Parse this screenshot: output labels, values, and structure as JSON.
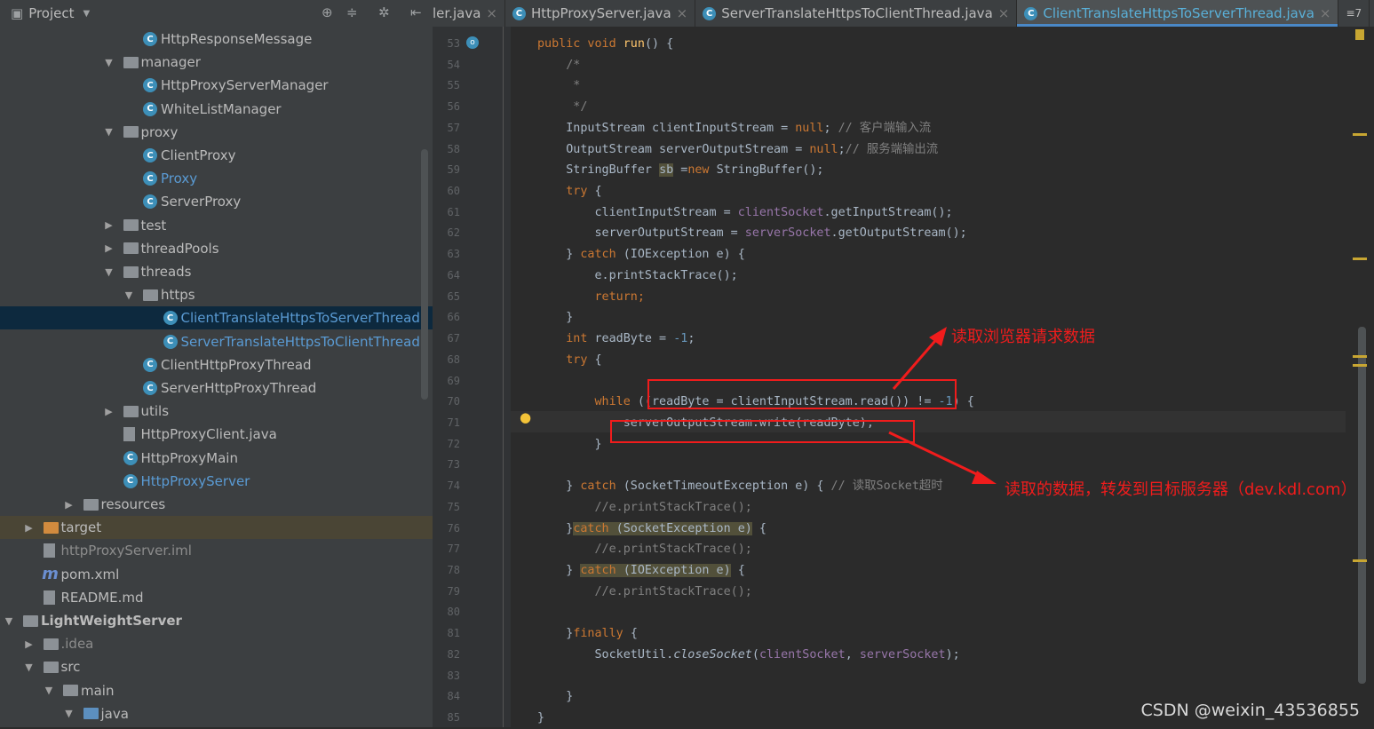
{
  "sidebar": {
    "title": "Project",
    "icons": [
      "project-icon",
      "dropdown-icon",
      "locate-icon",
      "collapse-icon",
      "gear-icon",
      "hide-icon"
    ],
    "items": [
      {
        "label": "HttpResponseMessage",
        "level": 6,
        "type": "class"
      },
      {
        "label": "manager",
        "level": 5,
        "type": "folder",
        "state": "expanded"
      },
      {
        "label": "HttpProxyServerManager",
        "level": 6,
        "type": "class"
      },
      {
        "label": "WhiteListManager",
        "level": 6,
        "type": "class"
      },
      {
        "label": "proxy",
        "level": 5,
        "type": "folder",
        "state": "expanded"
      },
      {
        "label": "ClientProxy",
        "level": 6,
        "type": "class"
      },
      {
        "label": "Proxy",
        "level": 6,
        "type": "class",
        "color": "blue"
      },
      {
        "label": "ServerProxy",
        "level": 6,
        "type": "class"
      },
      {
        "label": "test",
        "level": 5,
        "type": "folder",
        "state": "collapsed"
      },
      {
        "label": "threadPools",
        "level": 5,
        "type": "folder",
        "state": "collapsed"
      },
      {
        "label": "threads",
        "level": 5,
        "type": "folder",
        "state": "expanded"
      },
      {
        "label": "https",
        "level": 6,
        "type": "folder",
        "state": "expanded"
      },
      {
        "label": "ClientTranslateHttpsToServerThread",
        "level": 7,
        "type": "class",
        "color": "blue",
        "selected": true
      },
      {
        "label": "ServerTranslateHttpsToClientThread",
        "level": 7,
        "type": "class",
        "color": "blue"
      },
      {
        "label": "ClientHttpProxyThread",
        "level": 6,
        "type": "class"
      },
      {
        "label": "ServerHttpProxyThread",
        "level": 6,
        "type": "class"
      },
      {
        "label": "utils",
        "level": 5,
        "type": "folder",
        "state": "collapsed"
      },
      {
        "label": "HttpProxyClient.java",
        "level": 5,
        "type": "file"
      },
      {
        "label": "HttpProxyMain",
        "level": 5,
        "type": "class"
      },
      {
        "label": "HttpProxyServer",
        "level": 5,
        "type": "class",
        "color": "blue"
      },
      {
        "label": "resources",
        "level": 3,
        "type": "folder",
        "state": "collapsed"
      },
      {
        "label": "target",
        "level": 1,
        "type": "folder-orange",
        "state": "collapsed",
        "highlight": true
      },
      {
        "label": "httpProxyServer.iml",
        "level": 1,
        "type": "file",
        "color": "grey"
      },
      {
        "label": "pom.xml",
        "level": 1,
        "type": "maven"
      },
      {
        "label": "README.md",
        "level": 1,
        "type": "file"
      },
      {
        "label": "LightWeightServer",
        "level": 0,
        "type": "folder",
        "state": "expanded",
        "bold": true
      },
      {
        "label": ".idea",
        "level": 1,
        "type": "folder",
        "state": "collapsed",
        "color": "grey"
      },
      {
        "label": "src",
        "level": 1,
        "type": "folder",
        "state": "expanded"
      },
      {
        "label": "main",
        "level": 2,
        "type": "folder",
        "state": "expanded"
      },
      {
        "label": "java",
        "level": 3,
        "type": "folder-blue",
        "state": "expanded"
      }
    ]
  },
  "tabs": [
    {
      "label": "ler.java",
      "icon": false
    },
    {
      "label": "HttpProxyServer.java",
      "icon": true
    },
    {
      "label": "ServerTranslateHttpsToClientThread.java",
      "icon": true
    },
    {
      "label": "ClientTranslateHttpsToServerThread.java",
      "icon": true,
      "active": true
    }
  ],
  "tabs_overflow": "≡7",
  "editor": {
    "lines": [
      {
        "n": 53,
        "t": [
          [
            "public void ",
            "kw"
          ],
          [
            "run",
            "fn"
          ],
          [
            "() {",
            ""
          ]
        ]
      },
      {
        "n": 54,
        "t": [
          [
            "    /*",
            "cm"
          ]
        ]
      },
      {
        "n": 55,
        "t": [
          [
            "     *",
            "cm"
          ]
        ]
      },
      {
        "n": 56,
        "t": [
          [
            "     */",
            "cm"
          ]
        ]
      },
      {
        "n": 57,
        "t": [
          [
            "    InputStream clientInputStream = ",
            ""
          ],
          [
            "null",
            "kw"
          ],
          [
            "; ",
            ""
          ],
          [
            "// 客户端输入流",
            "cm"
          ]
        ]
      },
      {
        "n": 58,
        "t": [
          [
            "    OutputStream serverOutputStream = ",
            ""
          ],
          [
            "null",
            "kw"
          ],
          [
            ";",
            ""
          ],
          [
            "// 服务端输出流",
            "cm"
          ]
        ]
      },
      {
        "n": 59,
        "t": [
          [
            "    StringBuffer ",
            ""
          ],
          [
            "sb",
            "hlbg"
          ],
          [
            " =",
            ""
          ],
          [
            "new ",
            "kw"
          ],
          [
            "StringBuffer();",
            ""
          ]
        ]
      },
      {
        "n": 60,
        "t": [
          [
            "    try ",
            "kw"
          ],
          [
            "{",
            ""
          ]
        ]
      },
      {
        "n": 61,
        "t": [
          [
            "        clientInputStream = ",
            ""
          ],
          [
            "clientSocket",
            "fld"
          ],
          [
            ".getInputStream();",
            ""
          ]
        ]
      },
      {
        "n": 62,
        "t": [
          [
            "        serverOutputStream = ",
            ""
          ],
          [
            "serverSocket",
            "fld"
          ],
          [
            ".getOutputStream();",
            ""
          ]
        ]
      },
      {
        "n": 63,
        "t": [
          [
            "    } ",
            ""
          ],
          [
            "catch ",
            "kw"
          ],
          [
            "(IOException e) {",
            ""
          ]
        ]
      },
      {
        "n": 64,
        "t": [
          [
            "        e.printStackTrace();",
            ""
          ]
        ]
      },
      {
        "n": 65,
        "t": [
          [
            "        return;",
            "kw"
          ]
        ]
      },
      {
        "n": 66,
        "t": [
          [
            "    }",
            ""
          ]
        ]
      },
      {
        "n": 67,
        "t": [
          [
            "    int ",
            "kw"
          ],
          [
            "readByte = ",
            ""
          ],
          [
            "-1",
            "num"
          ],
          [
            ";",
            ""
          ]
        ]
      },
      {
        "n": 68,
        "t": [
          [
            "    try ",
            "kw"
          ],
          [
            "{",
            ""
          ]
        ]
      },
      {
        "n": 69,
        "t": []
      },
      {
        "n": 70,
        "t": [
          [
            "        while ",
            "kw"
          ],
          [
            "((readByte = clientInputStream.read()) != ",
            ""
          ],
          [
            "-1",
            "num"
          ],
          [
            ") {",
            ""
          ]
        ]
      },
      {
        "n": 71,
        "t": [
          [
            "            serverOutputStream.write(readByte);",
            ""
          ]
        ]
      },
      {
        "n": 72,
        "t": [
          [
            "        }",
            ""
          ]
        ]
      },
      {
        "n": 73,
        "t": []
      },
      {
        "n": 74,
        "t": [
          [
            "    } ",
            ""
          ],
          [
            "catch ",
            "kw"
          ],
          [
            "(SocketTimeoutException e) { ",
            ""
          ],
          [
            "// 读取Socket超时",
            "cm"
          ]
        ]
      },
      {
        "n": 75,
        "t": [
          [
            "        //e.printStackTrace();",
            "cm"
          ]
        ]
      },
      {
        "n": 76,
        "t": [
          [
            "    }",
            ""
          ],
          [
            "catch",
            "kw hlbg"
          ],
          [
            " (SocketException e)",
            "hlbg"
          ],
          [
            " {",
            ""
          ]
        ]
      },
      {
        "n": 77,
        "t": [
          [
            "        //e.printStackTrace();",
            "cm"
          ]
        ]
      },
      {
        "n": 78,
        "t": [
          [
            "    } ",
            ""
          ],
          [
            "catch",
            "kw hlbg"
          ],
          [
            " (IOException e)",
            "hlbg"
          ],
          [
            " {",
            ""
          ]
        ]
      },
      {
        "n": 79,
        "t": [
          [
            "        //e.printStackTrace();",
            "cm"
          ]
        ]
      },
      {
        "n": 80,
        "t": []
      },
      {
        "n": 81,
        "t": [
          [
            "    }",
            ""
          ],
          [
            "finally ",
            "kw"
          ],
          [
            "{",
            ""
          ]
        ]
      },
      {
        "n": 82,
        "t": [
          [
            "        SocketUtil.",
            ""
          ],
          [
            "closeSocket",
            "it"
          ],
          [
            "(",
            ""
          ],
          [
            "clientSocket",
            "fld"
          ],
          [
            ", ",
            ""
          ],
          [
            "serverSocket",
            "fld"
          ],
          [
            ");",
            ""
          ]
        ]
      },
      {
        "n": 83,
        "t": []
      },
      {
        "n": 84,
        "t": [
          [
            "    }",
            ""
          ]
        ]
      },
      {
        "n": 85,
        "t": [
          [
            "}",
            ""
          ]
        ]
      }
    ]
  },
  "annotations": {
    "read_browser": "读取浏览器请求数据",
    "forward": "读取的数据，转发到目标服务器（dev.kdl.com）",
    "color": "#f01c1c"
  },
  "watermark": "CSDN @weixin_43536855"
}
